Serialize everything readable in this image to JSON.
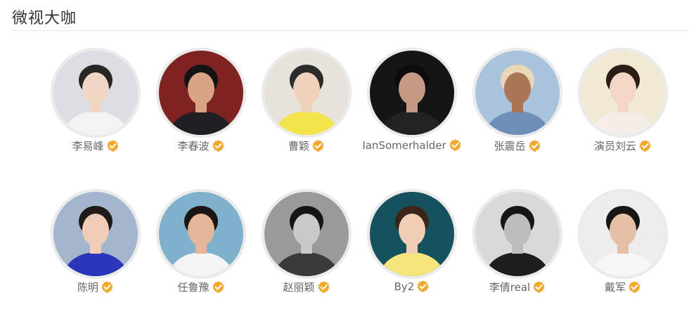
{
  "section": {
    "title": "微视大咖"
  },
  "verified_color": "#f0a82d",
  "verified_icon": "verified-badge-icon",
  "celebrities": [
    {
      "name": "李易峰",
      "bg": "#dcdde2",
      "skin": "#f0d6c4",
      "hair": "#2a2626",
      "cloth": "#f3f3f3"
    },
    {
      "name": "李春波",
      "bg": "#7e2322",
      "skin": "#d9a486",
      "hair": "#141414",
      "cloth": "#1f1f24"
    },
    {
      "name": "曹颖",
      "bg": "#e8e3da",
      "skin": "#efd2bb",
      "hair": "#2b2b2b",
      "cloth": "#f2e44a"
    },
    {
      "name": "IanSomerhalder",
      "bg": "#151515",
      "skin": "#c59a84",
      "hair": "#0c0c0c",
      "cloth": "#222222"
    },
    {
      "name": "张震岳",
      "bg": "#a9c3dc",
      "skin": "#a97758",
      "hair": "#e8d8b8",
      "cloth": "#6d8fb7"
    },
    {
      "name": "演员刘云",
      "bg": "#f1e9d3",
      "skin": "#f4d6c6",
      "hair": "#2b1c15",
      "cloth": "#f6efe8"
    },
    {
      "name": "陈明",
      "bg": "#a3b6ce",
      "skin": "#efcdb7",
      "hair": "#1e1a19",
      "cloth": "#2a37b8"
    },
    {
      "name": "任鲁豫",
      "bg": "#7fb1cc",
      "skin": "#e2b697",
      "hair": "#1b1614",
      "cloth": "#f4f4f4"
    },
    {
      "name": "赵丽颖",
      "bg": "#9a9a9a",
      "skin": "#c9c9c9",
      "hair": "#151515",
      "cloth": "#3a3a3a"
    },
    {
      "name": "By2",
      "bg": "#16515e",
      "skin": "#f0cdb5",
      "hair": "#3b2519",
      "cloth": "#f5e57d"
    },
    {
      "name": "李倩real",
      "bg": "#d9d9d9",
      "skin": "#bdbdbd",
      "hair": "#161616",
      "cloth": "#1e1e1e"
    },
    {
      "name": "戴军",
      "bg": "#ededed",
      "skin": "#e6c0a5",
      "hair": "#161616",
      "cloth": "#f7f7f7"
    }
  ]
}
